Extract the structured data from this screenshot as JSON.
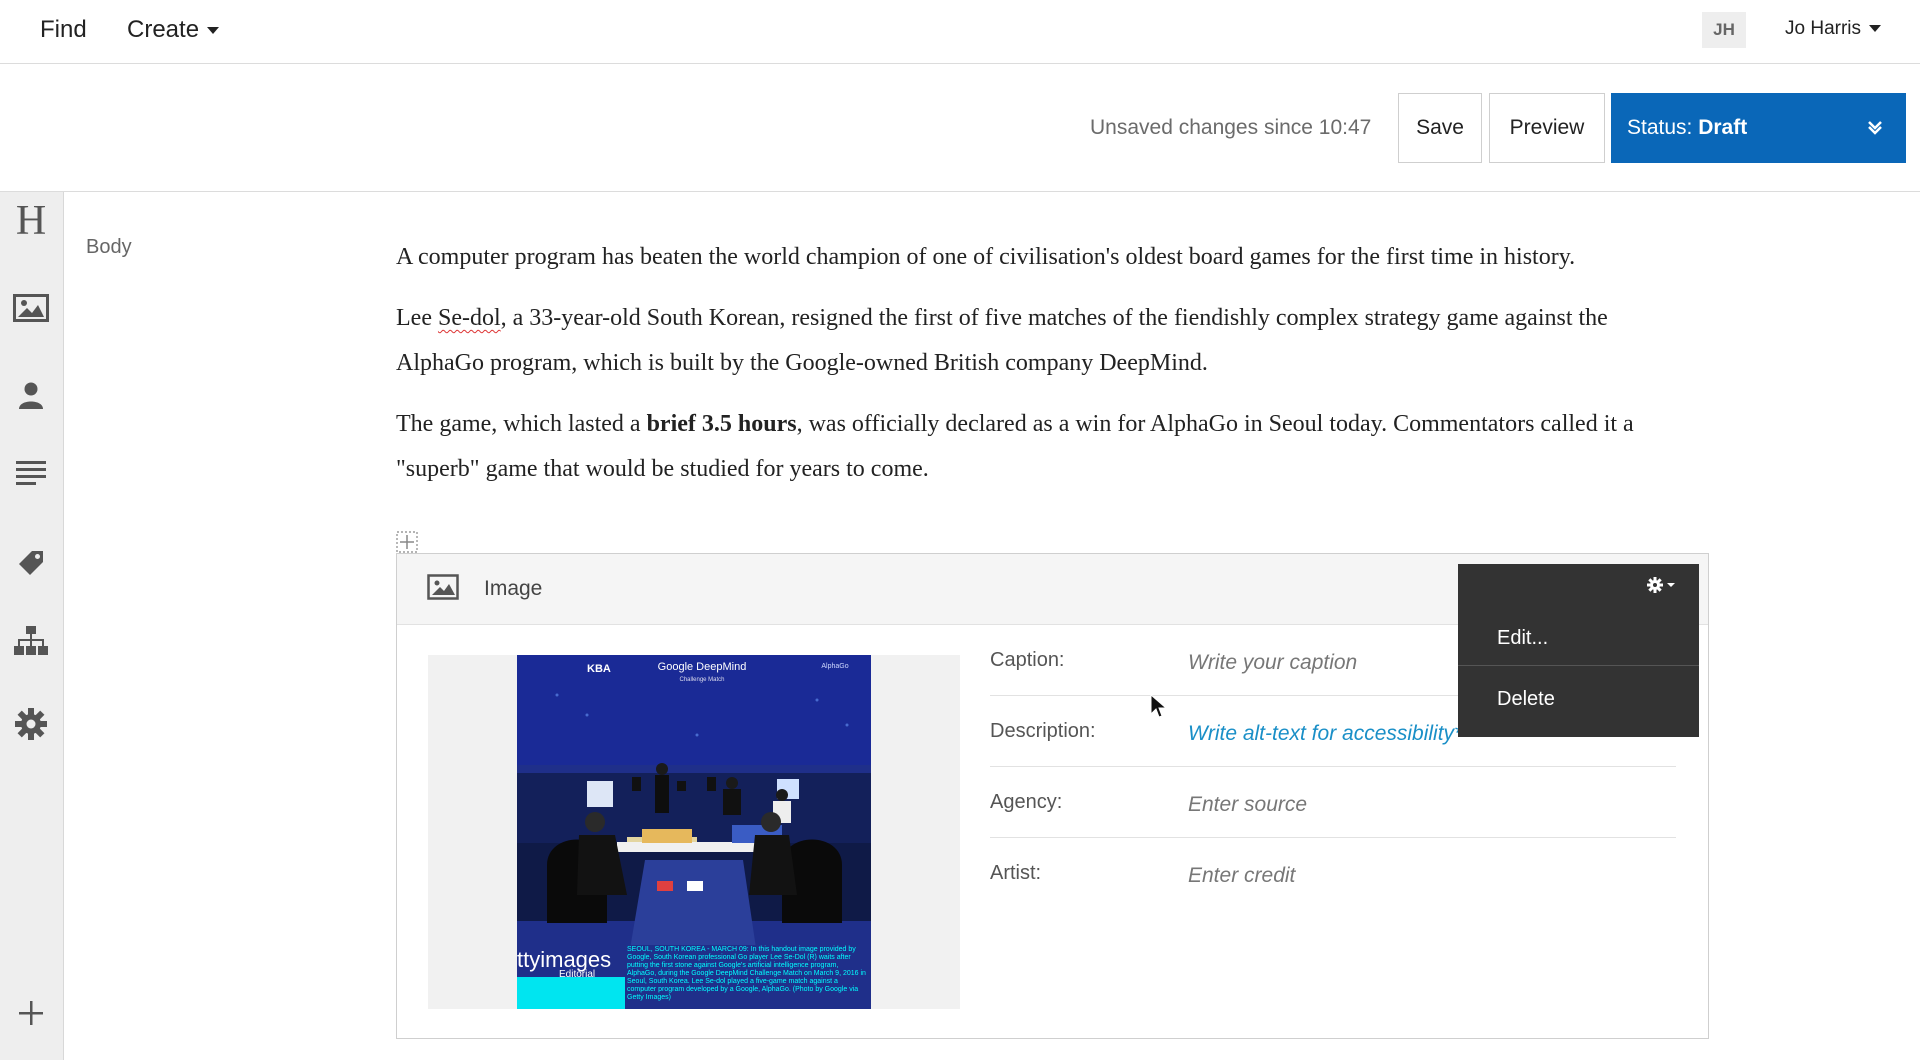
{
  "nav": {
    "find": "Find",
    "create": "Create",
    "avatar_initials": "JH",
    "user_name": "Jo Harris"
  },
  "toolbar": {
    "unsaved_text": "Unsaved changes since 10:47",
    "save_label": "Save",
    "preview_label": "Preview",
    "status_prefix": "Status:",
    "status_value": "Draft"
  },
  "sidebar": {
    "icons": [
      "heading-icon",
      "image-icon",
      "person-icon",
      "text-lines-icon",
      "tag-icon",
      "hierarchy-icon",
      "gear-icon",
      "plus-icon"
    ],
    "heading_glyph": "H"
  },
  "editor": {
    "field_label": "Body",
    "paragraphs": {
      "p1": "A computer program has beaten the world champion of one of civilisation's oldest board games for the first time in history.",
      "p2_before": "Lee ",
      "p2_misspelled": "Se-dol",
      "p2_after": ", a 33-year-old South Korean, resigned the first of five matches of the fiendishly complex strategy game against the AlphaGo program, which is built by the Google-owned British company DeepMind.",
      "p3_before": "The game, which lasted a ",
      "p3_bold": "brief 3.5 hours",
      "p3_after": ", was officially declared as a win for AlphaGo in Seoul today. Commentators called it a \"superb\" game that would be studied for years to come."
    }
  },
  "image_block": {
    "title": "Image",
    "menu": {
      "edit": "Edit...",
      "delete": "Delete"
    },
    "photo": {
      "logo_left": "KBA",
      "event_title": "Google DeepMind",
      "event_subtitle": "Challenge Match",
      "logo_right": "AlphaGo",
      "watermark_main": "ttyimages",
      "watermark_sub": "Editorial",
      "caption_strip": "SEOUL, SOUTH KOREA - MARCH 09: In this handout image provided by Google, South Korean professional Go player Lee Se-Dol (R) waits after putting the first stone against Google's artificial intelligence program, AlphaGo, during the Google DeepMind Challenge Match on March 9, 2016 in Seoul, South Korea. Lee Se-dol played a five-game match against a computer program developed by a Google, AlphaGo. (Photo by Google via Getty Images)"
    },
    "fields": [
      {
        "label": "Caption:",
        "value": "Write your caption"
      },
      {
        "label": "Description:",
        "value": "Write alt-text for accessibility*"
      },
      {
        "label": "Agency:",
        "value": "Enter source"
      },
      {
        "label": "Artist:",
        "value": "Enter credit"
      }
    ]
  },
  "colors": {
    "accent": "#0a67b8",
    "sidebar_bg": "#eeeeee",
    "menu_bg": "#333333",
    "alt_text_link": "#1a8fc7"
  }
}
